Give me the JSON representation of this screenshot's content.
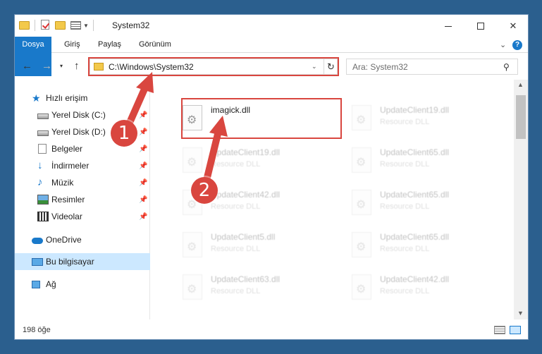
{
  "window": {
    "title": "System32",
    "minimize_glyph": "",
    "close_glyph": "✕"
  },
  "ribbon": {
    "tabs": [
      "Dosya",
      "Giriş",
      "Paylaş",
      "Görünüm"
    ],
    "expand_glyph": "⌄",
    "help_glyph": "?"
  },
  "nav": {
    "back_glyph": "←",
    "forward_glyph": "→",
    "recent_glyph": "▾",
    "up_glyph": "↑"
  },
  "address": {
    "path": "C:\\Windows\\System32",
    "dropdown_glyph": "⌄",
    "refresh_glyph": "↻"
  },
  "search": {
    "placeholder": "Ara: System32",
    "icon_glyph": "⚲"
  },
  "sidebar": {
    "items": [
      {
        "label": "Hızlı erişim",
        "icon": "star-icon"
      },
      {
        "label": "Yerel Disk (C:)",
        "icon": "disk-icon",
        "pinned": true
      },
      {
        "label": "Yerel Disk (D:)",
        "icon": "disk-icon",
        "pinned": true
      },
      {
        "label": "Belgeler",
        "icon": "documents-icon",
        "pinned": true
      },
      {
        "label": "İndirmeler",
        "icon": "downloads-icon",
        "pinned": true
      },
      {
        "label": "Müzik",
        "icon": "music-icon",
        "pinned": true
      },
      {
        "label": "Resimler",
        "icon": "pictures-icon",
        "pinned": true
      },
      {
        "label": "Videolar",
        "icon": "videos-icon",
        "pinned": true
      },
      {
        "label": "OneDrive",
        "icon": "onedrive-icon"
      },
      {
        "label": "Bu bilgisayar",
        "icon": "this-pc-icon",
        "selected": true
      },
      {
        "label": "Ağ",
        "icon": "network-icon"
      }
    ],
    "pin_glyph": "📌"
  },
  "files": [
    {
      "name": "imagick.dll",
      "type": "",
      "highlighted": true
    },
    {
      "name": "UpdateClient19.dll",
      "type": "Resource DLL"
    },
    {
      "name": "UpdateClient19.dll",
      "type": "Resource DLL"
    },
    {
      "name": "UpdateClient65.dll",
      "type": "Resource DLL"
    },
    {
      "name": "UpdateClient42.dll",
      "type": "Resource DLL"
    },
    {
      "name": "UpdateClient65.dll",
      "type": "Resource DLL"
    },
    {
      "name": "UpdateClient5.dll",
      "type": "Resource DLL"
    },
    {
      "name": "UpdateClient65.dll",
      "type": "Resource DLL"
    },
    {
      "name": "UpdateClient63.dll",
      "type": "Resource DLL"
    },
    {
      "name": "UpdateClient42.dll",
      "type": "Resource DLL"
    }
  ],
  "scrollbar": {
    "up_glyph": "▲",
    "down_glyph": "▼"
  },
  "status": {
    "item_count": "198 öğe"
  },
  "annotations": {
    "step1": "1",
    "step2": "2",
    "accent_color": "#d9463f"
  },
  "colors": {
    "accent": "#1979ca",
    "selection": "#cce8ff"
  }
}
